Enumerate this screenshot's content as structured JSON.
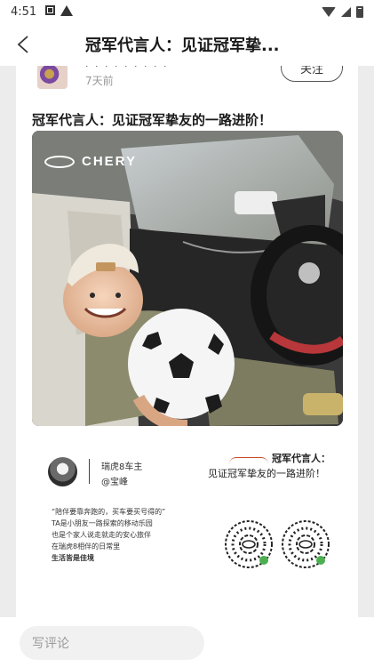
{
  "status_bar": {
    "time": "4:51"
  },
  "header": {
    "title": "冠军代言人：见证冠军挚..."
  },
  "author": {
    "name_fragment": "· · ·  · ·  · · · ·",
    "time_ago": "7天前",
    "follow_label": "关注"
  },
  "post": {
    "title": "冠军代言人：见证冠军挚友的一路进阶！",
    "brand_text": "CHERY"
  },
  "poster": {
    "owner_model": "瑞虎8车主",
    "owner_handle": "@宝峰",
    "promo_title_1": "冠军代言人：",
    "promo_title_2": "见证冠军挚友的一路进阶！",
    "quote_lines": [
      "“陪伴要靠奔跑的，买车要买号得的”",
      "TA是小朋友一路探索的移动乐园",
      "也是个家人说走就走的安心旅伴",
      "在瑞虎8相伴的日常里"
    ],
    "quote_last": "生活皆是佳境"
  },
  "comment": {
    "placeholder": "写评论"
  }
}
